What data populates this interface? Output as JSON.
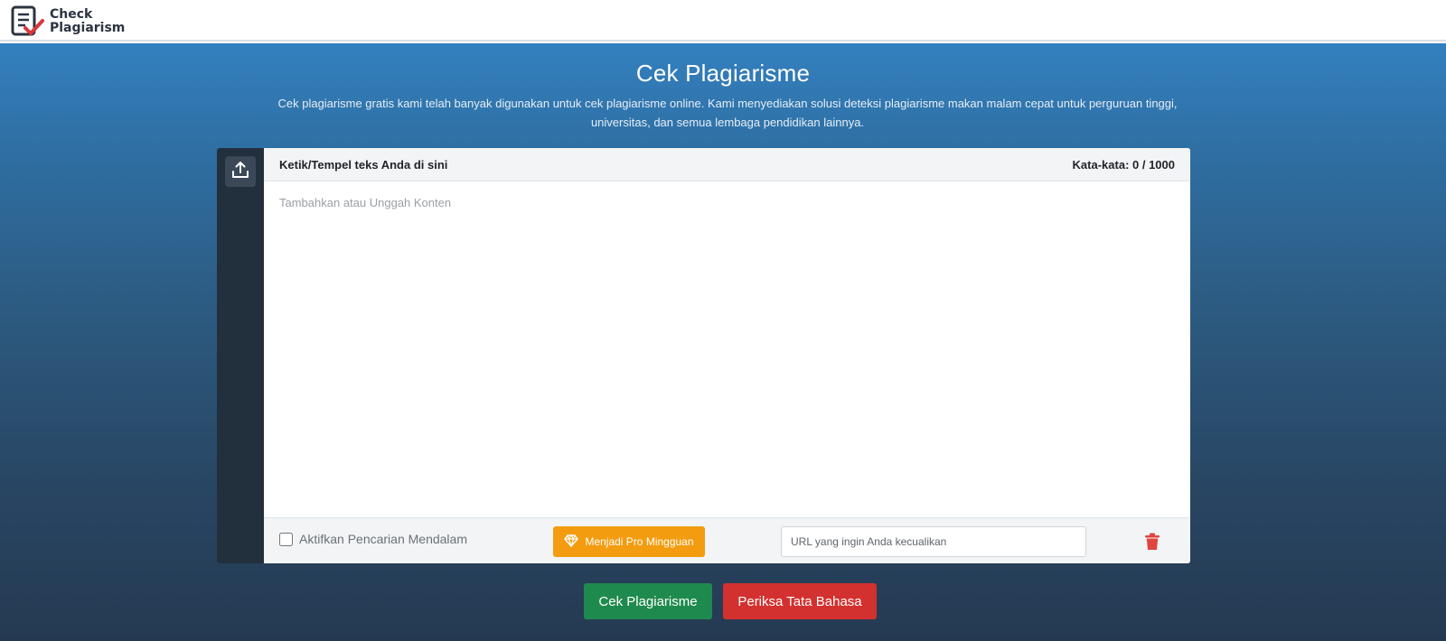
{
  "header": {
    "logo_line1": "Check",
    "logo_line2": "Plagiarism"
  },
  "hero": {
    "title": "Cek Plagiarisme",
    "subtitle": "Cek plagiarisme gratis kami telah banyak digunakan untuk cek plagiarisme online. Kami menyediakan solusi deteksi plagiarisme makan malam cepat untuk perguruan tinggi, universitas, dan semua lembaga pendidikan lainnya."
  },
  "editor": {
    "label": "Ketik/Tempel teks Anda di sini",
    "word_count": "Kata-kata: 0 / 1000",
    "value": "",
    "placeholder": "Tambahkan atau Unggah Konten"
  },
  "footer": {
    "deep_search_label": "Aktifkan Pencarian Mendalam",
    "deep_search_checked": false,
    "pro_label": "Menjadi Pro Mingguan",
    "url_placeholder": "URL yang ingin Anda kecualikan",
    "url_value": ""
  },
  "actions": {
    "check_label": "Cek Plagiarisme",
    "grammar_label": "Periksa Tata Bahasa"
  },
  "icons": {
    "logo": "document-check-icon",
    "upload": "upload-icon",
    "pro": "diamond-icon",
    "delete": "trash-icon"
  },
  "colors": {
    "accent_blue": "#3380bf",
    "pro_orange": "#f39c0f",
    "check_green": "#1f8a4d",
    "grammar_red": "#d3312f",
    "trash_red": "#e0463e"
  }
}
